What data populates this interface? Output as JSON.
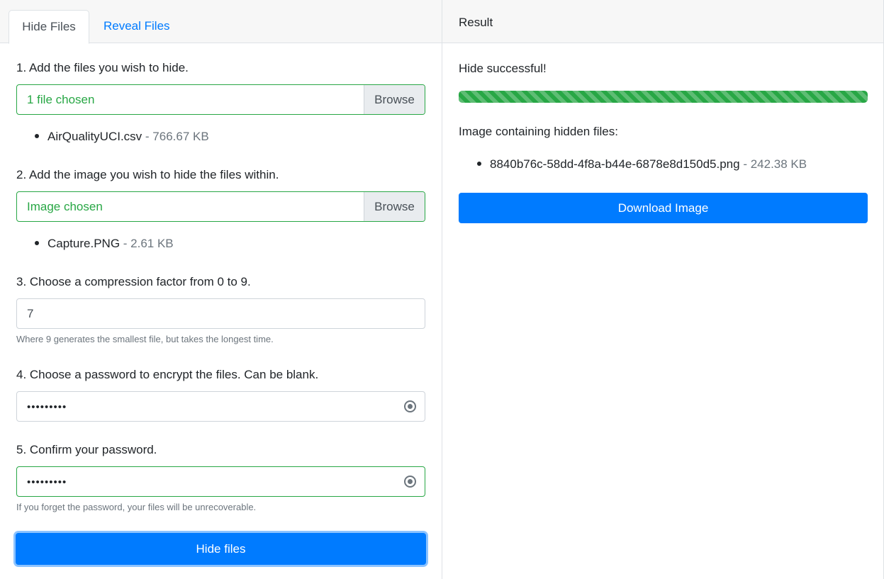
{
  "tabs": [
    {
      "label": "Hide Files",
      "active": true
    },
    {
      "label": "Reveal Files",
      "active": false
    }
  ],
  "step1": {
    "label": "1. Add the files you wish to hide.",
    "status": "1 file chosen",
    "browse": "Browse",
    "file_name": "AirQualityUCI.csv",
    "file_size": " - 766.67 KB"
  },
  "step2": {
    "label": "2. Add the image you wish to hide the files within.",
    "status": "Image chosen",
    "browse": "Browse",
    "file_name": "Capture.PNG",
    "file_size": " - 2.61 KB"
  },
  "step3": {
    "label": "3. Choose a compression factor from 0 to 9.",
    "value": "7",
    "help": "Where 9 generates the smallest file, but takes the longest time."
  },
  "step4": {
    "label": "4. Choose a password to encrypt the files. Can be blank.",
    "masked": "•••••••••"
  },
  "step5": {
    "label": "5. Confirm your password.",
    "masked": "•••••••••",
    "help": "If you forget the password, your files will be unrecoverable."
  },
  "hide_button": "Hide files",
  "result": {
    "header": "Result",
    "status": "Hide successful!",
    "progress": 1.0,
    "image_label": "Image containing hidden files:",
    "file_name": "8840b76c-58dd-4f8a-b44e-6878e8d150d5.png",
    "file_size": " - 242.38 KB",
    "download_button": "Download Image"
  },
  "colors": {
    "primary": "#007bff",
    "success": "#28a745",
    "muted": "#6c757d"
  }
}
